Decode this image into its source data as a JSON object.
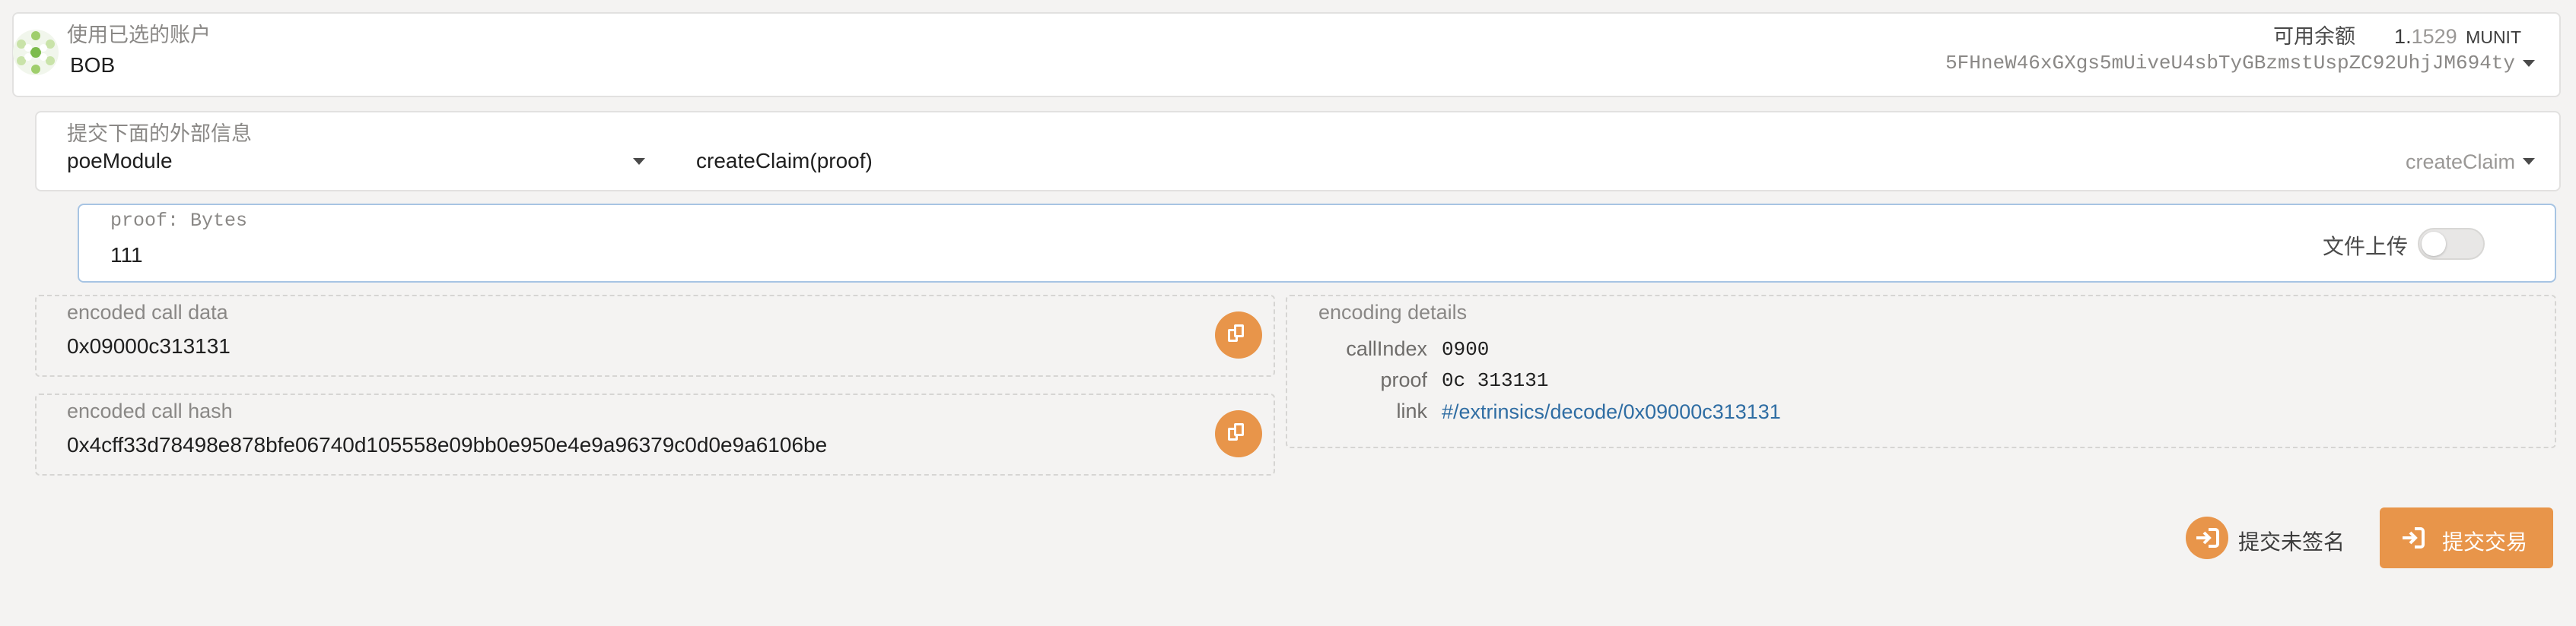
{
  "colors": {
    "accent": "#e8954a",
    "link": "#2f6da3",
    "background": "#f4f3f2"
  },
  "account": {
    "label": "使用已选的账户",
    "name": "BOB",
    "balance_label": "可用余额",
    "balance_int": "1.",
    "balance_frac": "1529",
    "balance_unit": "MUNIT",
    "address": "5FHneW46xGXgs5mUiveU4sbTyGBzmstUspZC92UhjJM694ty"
  },
  "extrinsic": {
    "label": "提交下面的外部信息",
    "module": "poeModule",
    "call": "createClaim(proof)",
    "call_short": "createClaim"
  },
  "param": {
    "label": "proof: Bytes",
    "value": "111",
    "upload_label": "文件上传"
  },
  "encoded_data": {
    "label": "encoded call data",
    "value": "0x09000c313131"
  },
  "encoded_hash": {
    "label": "encoded call hash",
    "value": "0x4cff33d78498e878bfe06740d105558e09bb0e950e4e9a96379c0d0e9a6106be"
  },
  "details": {
    "title": "encoding details",
    "callindex_label": "callIndex",
    "callindex_value": "0900",
    "proof_label": "proof",
    "proof_value": "0c 313131",
    "link_label": "link",
    "link_value": "#/extrinsics/decode/0x09000c313131"
  },
  "actions": {
    "unsigned_label": "提交未签名",
    "submit_label": "提交交易"
  },
  "icons": {
    "identicon": "identicon-icon",
    "copy": "copy-icon",
    "sign": "sign-in-icon"
  }
}
